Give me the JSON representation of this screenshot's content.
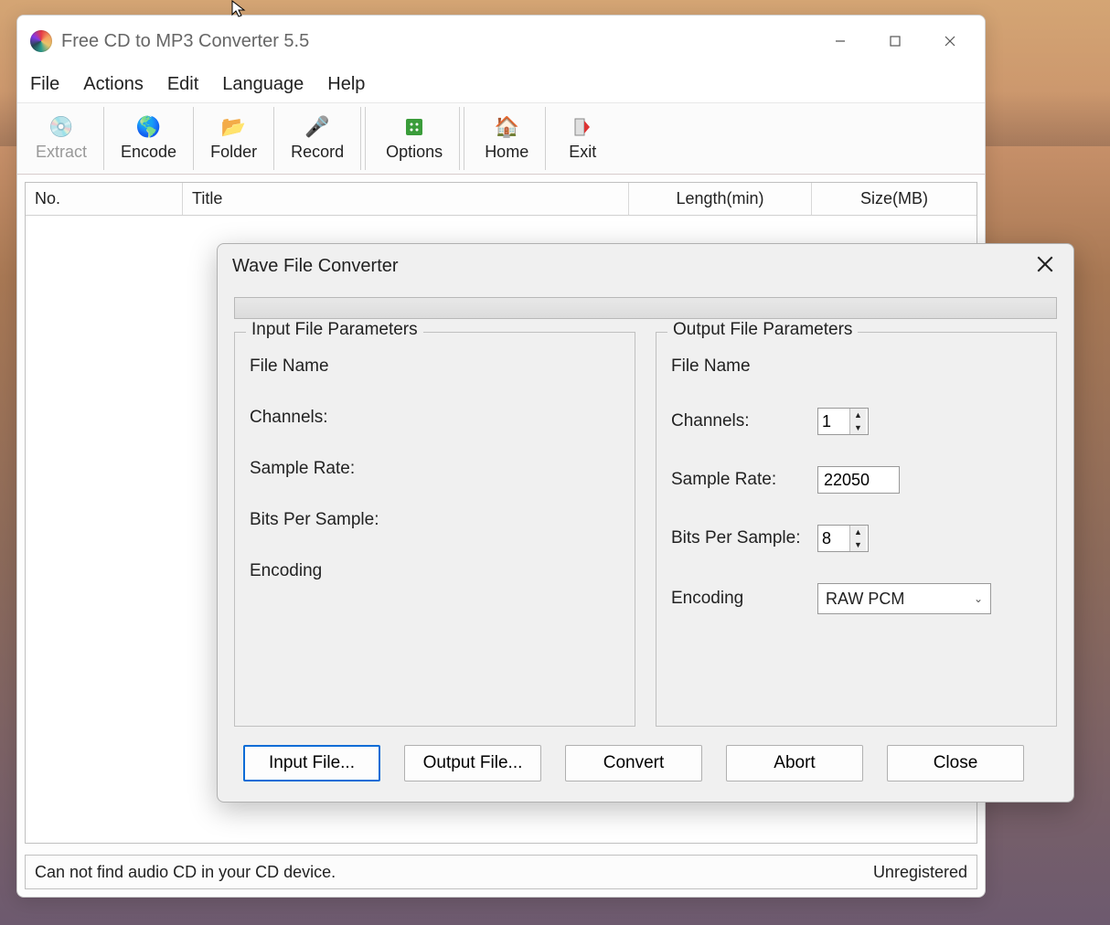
{
  "app": {
    "title": "Free CD to MP3 Converter 5.5"
  },
  "menu": {
    "file": "File",
    "actions": "Actions",
    "edit": "Edit",
    "language": "Language",
    "help": "Help"
  },
  "toolbar": {
    "extract": "Extract",
    "encode": "Encode",
    "folder": "Folder",
    "record": "Record",
    "options": "Options",
    "home": "Home",
    "exit": "Exit"
  },
  "table": {
    "no": "No.",
    "title": "Title",
    "length": "Length(min)",
    "size": "Size(MB)"
  },
  "status": {
    "left": "Can not find audio CD in your CD device.",
    "right": "Unregistered"
  },
  "dialog": {
    "title": "Wave File Converter",
    "input_legend": "Input File Parameters",
    "output_legend": "Output File Parameters",
    "labels": {
      "filename": "File Name",
      "channels": "Channels:",
      "samplerate": "Sample Rate:",
      "bits": "Bits Per Sample:",
      "encoding": "Encoding"
    },
    "output": {
      "channels": "1",
      "samplerate": "22050",
      "bits": "8",
      "encoding": "RAW PCM"
    },
    "buttons": {
      "input_file": "Input File...",
      "output_file": "Output File...",
      "convert": "Convert",
      "abort": "Abort",
      "close": "Close"
    }
  }
}
